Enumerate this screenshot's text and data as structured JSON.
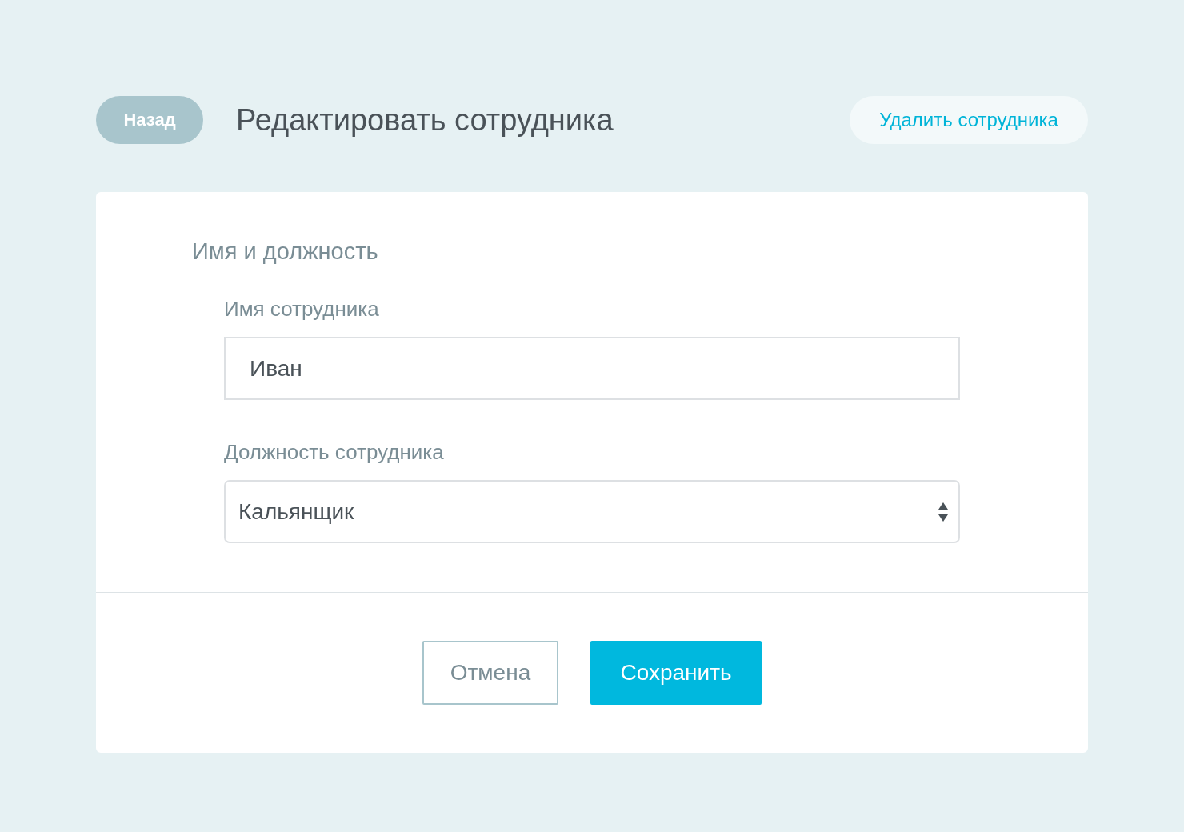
{
  "header": {
    "back_button": "Назад",
    "title": "Редактировать сотрудника",
    "delete_button": "Удалить сотрудника"
  },
  "section_title": "Имя и должность",
  "fields": [
    {
      "kind": "text",
      "label": "Имя сотрудника",
      "value": "Иван"
    },
    {
      "kind": "select",
      "label": "Должность сотрудника",
      "value": "Кальянщик"
    }
  ],
  "buttons": {
    "cancel": "Отмена",
    "save": "Сохранить"
  }
}
